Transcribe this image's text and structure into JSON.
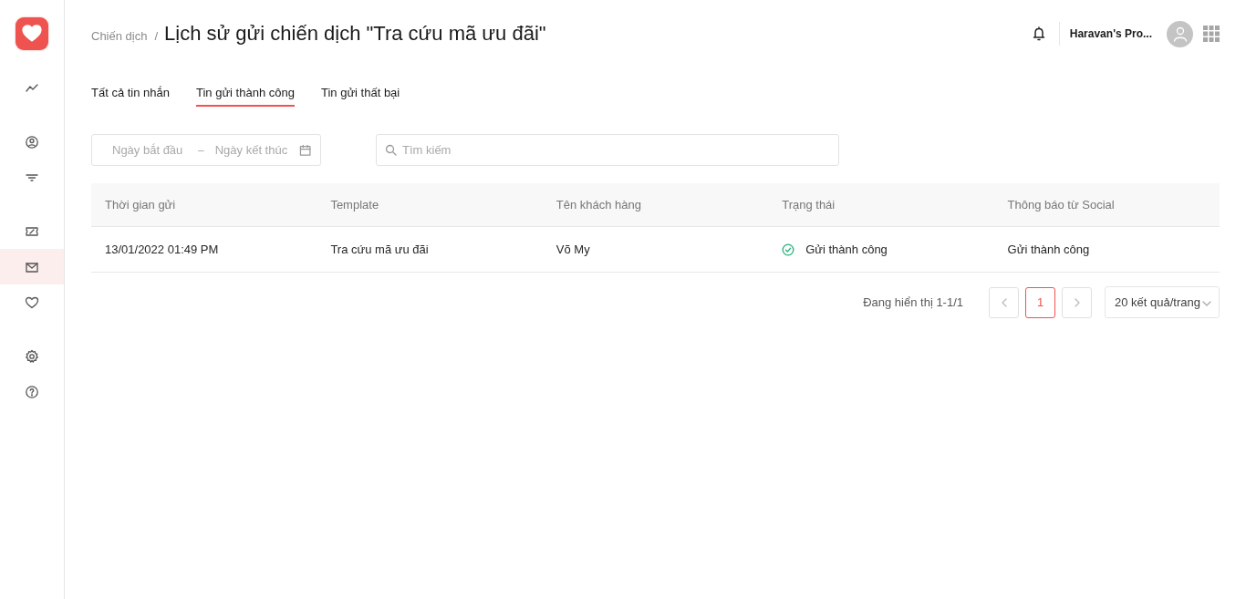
{
  "sidebar": {
    "items": [
      {
        "selected": false
      },
      {
        "selected": false
      },
      {
        "selected": false
      },
      {
        "selected": false
      },
      {
        "selected": true
      },
      {
        "selected": false
      },
      {
        "selected": false
      },
      {
        "selected": false
      }
    ]
  },
  "header": {
    "breadcrumb": "Chiến dịch",
    "separator": "/",
    "title": "Lịch sử gửi chiến dịch \"Tra cứu mã ưu đãi\"",
    "account": "Haravan's Pro..."
  },
  "tabs": [
    {
      "label": "Tất cả tin nhắn",
      "selected": false
    },
    {
      "label": "Tin gửi thành công",
      "selected": true
    },
    {
      "label": "Tin gửi thất bại",
      "selected": false
    }
  ],
  "filters": {
    "start_date": {
      "placeholder": "Ngày bắt đầu"
    },
    "date_separator": "–",
    "end_date": {
      "placeholder": "Ngày kết thúc"
    },
    "search": {
      "placeholder": "Tìm kiếm"
    }
  },
  "table": {
    "columns": [
      "Thời gian gửi",
      "Template",
      "Tên khách hàng",
      "Trạng thái",
      "Thông báo từ Social"
    ],
    "rows": [
      {
        "time": "13/01/2022 01:49 PM",
        "template": "Tra cứu mã ưu đãi",
        "customer": "Võ My",
        "status": {
          "text": "Gửi thành công",
          "kind": "success"
        },
        "social": "Gửi thành công"
      }
    ]
  },
  "pagination": {
    "summary": "Đang hiển thị 1-1/1",
    "pages": [
      {
        "label": "1",
        "selected": true
      }
    ],
    "page_size": "20 kết quả/trang"
  }
}
